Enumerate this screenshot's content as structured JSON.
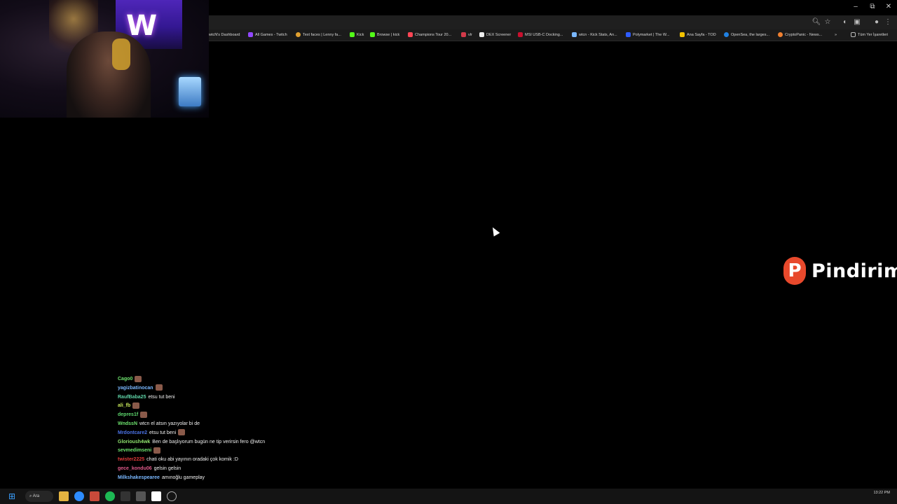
{
  "browser": {
    "bookmarks": [
      "wtcN's Dashboard",
      "All Games - Twitch",
      "Text faces | Lenny fa...",
      "Kick",
      "Browse | kick",
      "Champions Tour 20...",
      "vlr",
      "DEX Screener",
      "MSI USB-C Docking...",
      "wtcn - Kick Stats, An...",
      "Polymarket | The W...",
      "Ana Sayfa - TOD",
      "OpenSea, the larges...",
      "CryptoPanic - News...",
      "Tüm Yer İşaretleri"
    ],
    "overflow_label": "»",
    "window_controls": {
      "minimize": "–",
      "restore": "⧉",
      "close": "✕"
    }
  },
  "overlay": {
    "logo_mark": "P",
    "logo_text": "Pindirim"
  },
  "chat": [
    {
      "user": "Cago0",
      "color": "#6ee36e",
      "message": "",
      "emote": true
    },
    {
      "user": "yagizbatinocan",
      "color": "#7ab8ff",
      "message": "",
      "emote": true
    },
    {
      "user": "RaufBaba25",
      "color": "#5fd4a8",
      "message": "etsu tut beni",
      "emote": false
    },
    {
      "user": "ali_fb",
      "color": "#c8e85a",
      "message": "",
      "emote": true
    },
    {
      "user": "depres1f",
      "color": "#5ed86e",
      "message": "",
      "emote": true
    },
    {
      "user": "WndssN",
      "color": "#6ee36e",
      "message": "wtcn el atsın yazıyolar bi de",
      "emote": false
    },
    {
      "user": "Mrdontcare2",
      "color": "#4b73e6",
      "message": "etsu tut beni",
      "emote": true
    },
    {
      "user": "Glorioush4wk",
      "color": "#8fe36e",
      "message": "Ben de başlıyorum bugün ne tip verirsin fero @wtcn",
      "emote": false
    },
    {
      "user": "sevmedimseni",
      "color": "#6ee36e",
      "message": "",
      "emote": true
    },
    {
      "user": "twister2225",
      "color": "#e03a3a",
      "message": "chati oku abi yayının oradaki çok komik :D",
      "emote": false
    },
    {
      "user": "gece_kondu06",
      "color": "#e05a8a",
      "message": "gelsin gelsin",
      "emote": false
    },
    {
      "user": "Milkshakespearee",
      "color": "#7ab8ff",
      "message": "amınoğlu gameplay",
      "emote": false
    }
  ],
  "taskbar": {
    "search_label": "Ara",
    "clock_time": "13:22 PM"
  }
}
